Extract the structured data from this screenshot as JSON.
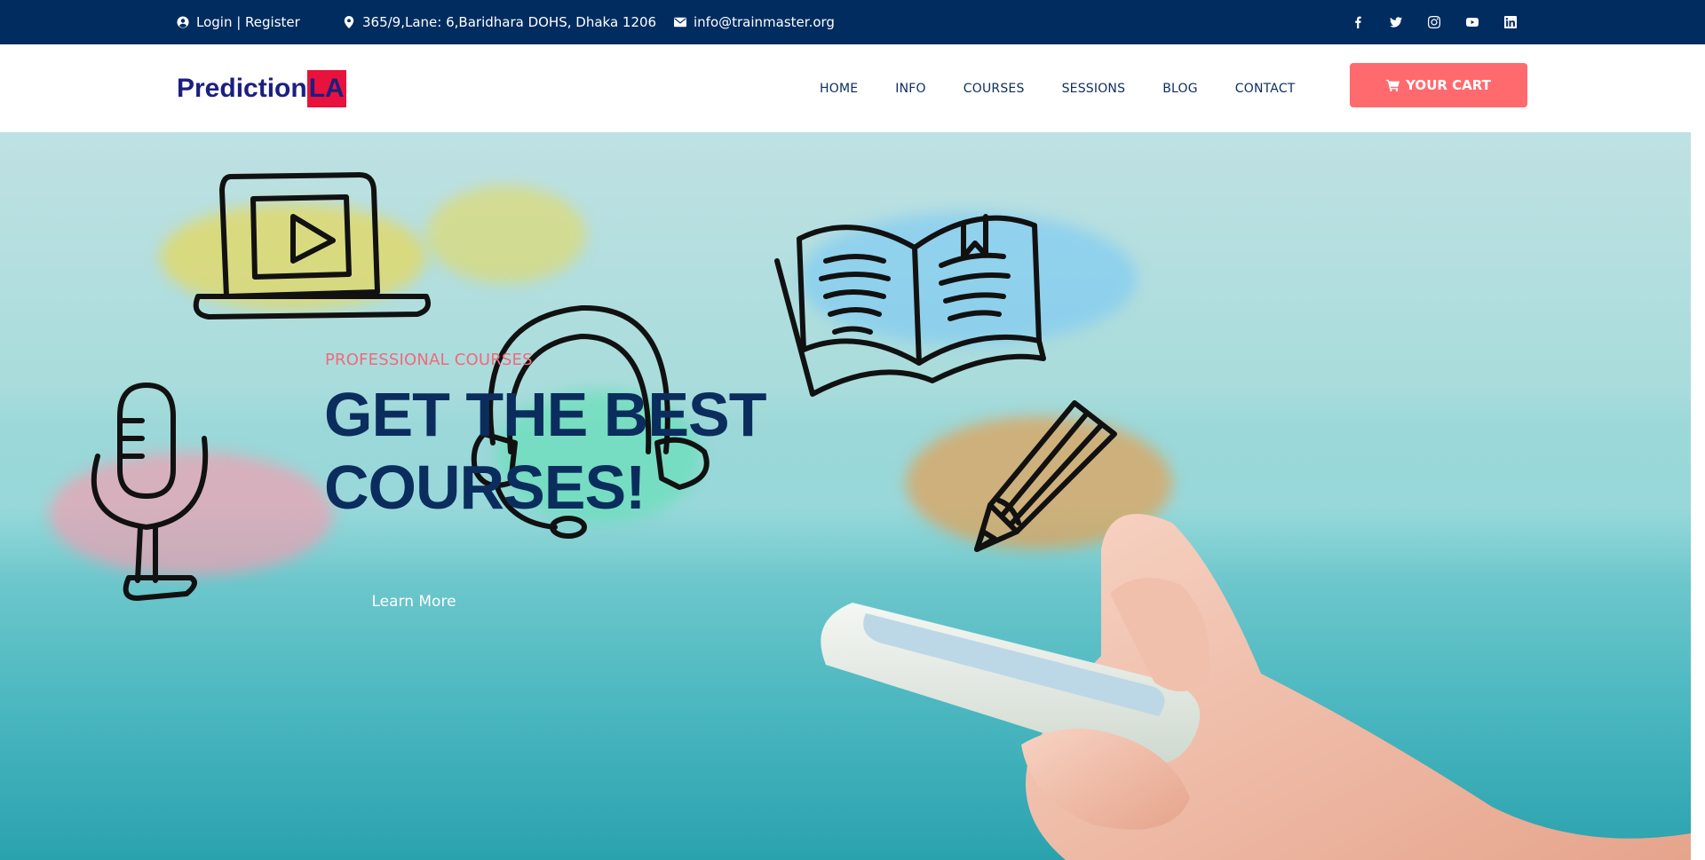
{
  "topbar": {
    "login": "Login | Register",
    "address": "365/9,Lane: 6,Baridhara DOHS, Dhaka 1206",
    "email": "info@trainmaster.org",
    "icons": [
      "user-circle-icon",
      "map-pin-icon",
      "envelope-icon"
    ],
    "social": [
      "facebook-icon",
      "twitter-icon",
      "instagram-icon",
      "youtube-icon",
      "linkedin-icon"
    ]
  },
  "logo": {
    "part1": "Prediction",
    "part2": "LA"
  },
  "nav": {
    "items": [
      "HOME",
      "INFO",
      "COURSES",
      "SESSIONS",
      "BLOG",
      "CONTACT"
    ],
    "cart_label": "YOUR CART"
  },
  "hero": {
    "subtitle": "PROFESSIONAL COURSES",
    "title": "GET THE BEST COURSES!",
    "button": "Learn More"
  },
  "colors": {
    "topbar_bg": "#002c5f",
    "accent": "#ff6a6f",
    "navy": "#0b2d5e",
    "logo_red": "#e8123c"
  }
}
